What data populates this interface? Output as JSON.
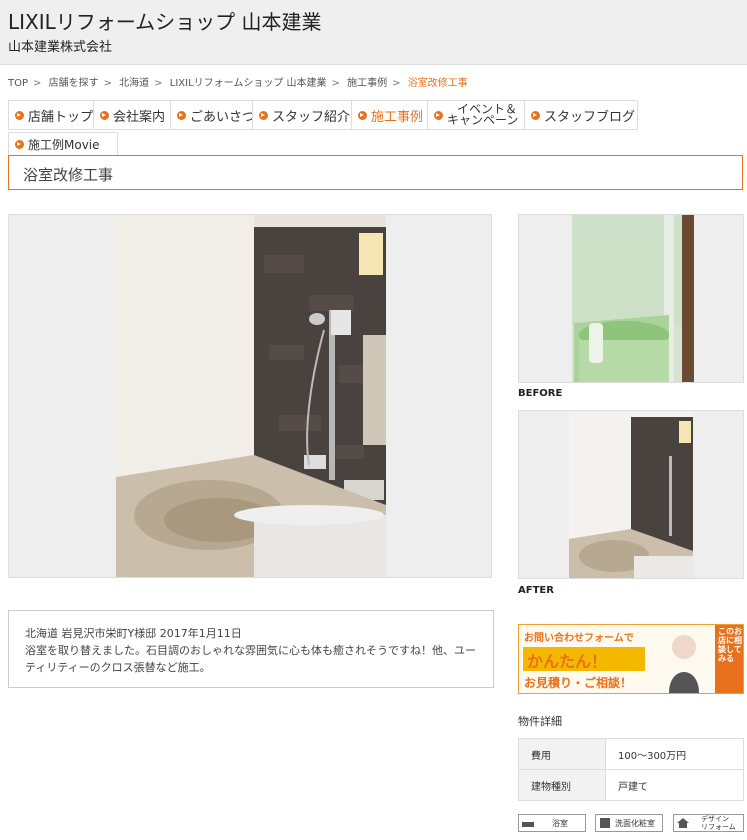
{
  "header": {
    "shop_name": "LIXILリフォームショップ 山本建業",
    "company": "山本建業株式会社"
  },
  "breadcrumb": {
    "items": [
      "TOP",
      "店舗を探す",
      "北海道",
      "LIXILリフォームショップ 山本建業",
      "施工事例"
    ],
    "current": "浴室改修工事"
  },
  "nav": {
    "items": [
      "店舗トップ",
      "会社案内",
      "ごあいさつ",
      "スタッフ紹介",
      "施工事例",
      "イベント＆",
      "キャンペーン",
      "スタッフブログ",
      "施工例Movie"
    ]
  },
  "page_title": "浴室改修工事",
  "thumbs": {
    "before_label": "BEFORE",
    "after_label": "AFTER"
  },
  "description": {
    "meta": "北海道 岩見沢市栄町Y様邸  2017年1月11日",
    "body": "浴室を取り替えました。石目調のおしゃれな雰囲気に心も体も癒されそうですね！他、ユーティリティーのクロス張替など施工。"
  },
  "banner": {
    "line1": "お問い合わせフォームで",
    "line2": "かんたん！",
    "line3": "お見積り・ご相談！",
    "side": "このお店に相談してみる"
  },
  "details": {
    "heading": "物件詳細",
    "rows": [
      {
        "key": "費用",
        "value": "100〜300万円"
      },
      {
        "key": "建物種別",
        "value": "戸建て"
      }
    ]
  },
  "tags": [
    "浴室",
    "洗面化粧室",
    "デザイン",
    "リフォーム"
  ]
}
